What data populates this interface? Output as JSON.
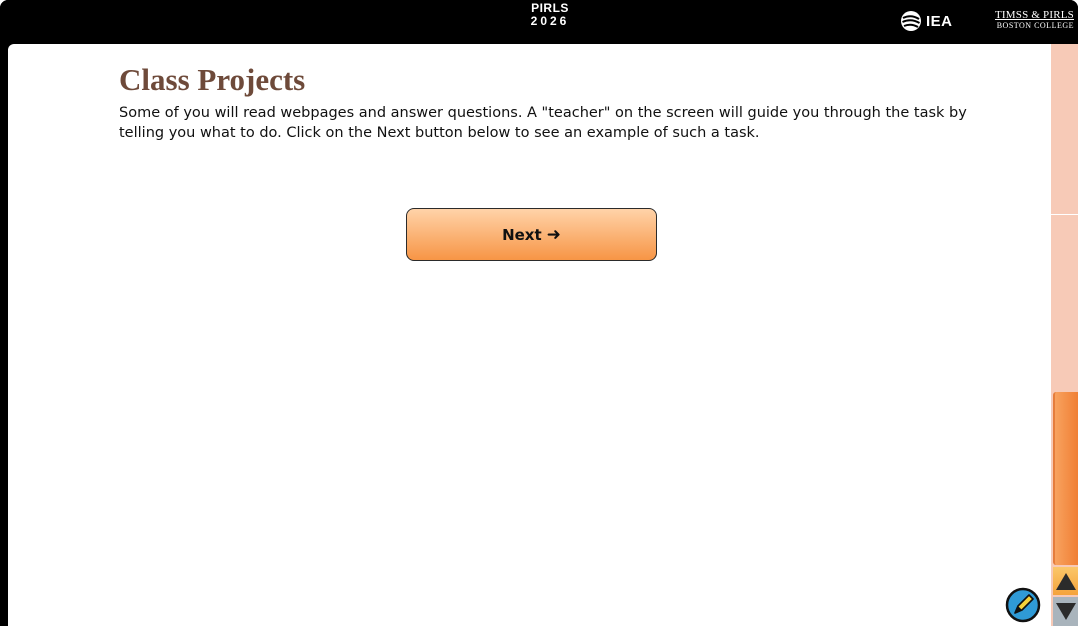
{
  "header": {
    "brand_line1": "PIRLS",
    "brand_line2": "2026",
    "org_label": "IEA",
    "partner_line1": "TIMSS & PIRLS",
    "partner_line2": "BOSTON COLLEGE"
  },
  "page": {
    "title": "Class Projects",
    "intro": "Some of you will read webpages and answer questions. A \"teacher\" on the screen will guide you through the task by telling you what to do. Click on the Next button below to see an example of such a task."
  },
  "next_button": {
    "label": "Next",
    "arrow_glyph": "➜"
  },
  "icons": {
    "iea_logo": "iea-globe-icon",
    "pen_tool": "pencil-tool-icon",
    "scroll_up": "arrow-up-icon",
    "scroll_down": "arrow-down-icon"
  },
  "colors": {
    "header_bg": "#000000",
    "title": "#6e4a3a",
    "button_top": "#ffd3a9",
    "button_bottom": "#f79545",
    "scroll_track": "#f7cab7",
    "scroll_thumb": "#f07f34"
  }
}
